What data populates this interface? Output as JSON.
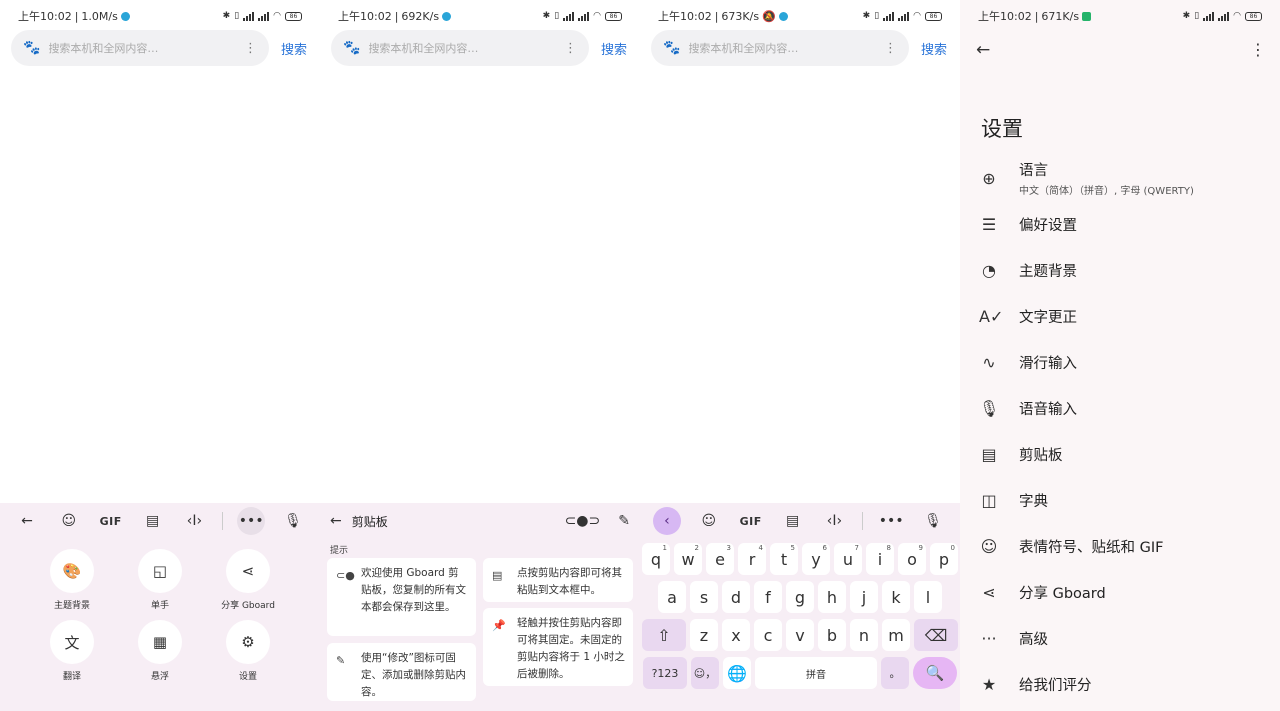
{
  "colors": {
    "accent_blue": "#2a74d8",
    "keyboard_bg": "#f7eef5",
    "key_fn": "#e9d8f0",
    "key_enter": "#e6b6f4",
    "settings_bg": "#fbf6f7"
  },
  "panels": [
    {
      "status": {
        "time": "上午10:02",
        "speed": "1.0M/s",
        "battery": "86"
      }
    },
    {
      "status": {
        "time": "上午10:02",
        "speed": "692K/s",
        "battery": "86"
      }
    },
    {
      "status": {
        "time": "上午10:02",
        "speed": "673K/s",
        "battery": "86"
      }
    },
    {
      "status": {
        "time": "上午10:02",
        "speed": "671K/s",
        "battery": "86"
      }
    }
  ],
  "search": {
    "placeholder": "搜索本机和全网内容…",
    "button": "搜索"
  },
  "toolbar": {
    "gif": "GIF"
  },
  "menu": {
    "items": [
      {
        "label": "主题背景",
        "icon": "palette-icon"
      },
      {
        "label": "单手",
        "icon": "one-hand-icon"
      },
      {
        "label": "分享 Gboard",
        "icon": "share-icon"
      },
      {
        "label": "翻译",
        "icon": "translate-icon"
      },
      {
        "label": "悬浮",
        "icon": "floating-keyboard-icon"
      },
      {
        "label": "设置",
        "icon": "gear-icon"
      }
    ]
  },
  "clipboard": {
    "title": "剪贴板",
    "tips_label": "提示",
    "tips": [
      "欢迎使用 Gboard 剪贴板，您复制的所有文本都会保存到这里。",
      "使用“修改”图标可固定、添加或删除剪贴内容。",
      "点按剪贴内容即可将其粘贴到文本框中。",
      "轻触并按住剪贴内容即可将其固定。未固定的剪贴内容将于 1 小时之后被删除。"
    ]
  },
  "keyboard": {
    "row1": [
      {
        "k": "q",
        "n": "1"
      },
      {
        "k": "w",
        "n": "2"
      },
      {
        "k": "e",
        "n": "3"
      },
      {
        "k": "r",
        "n": "4"
      },
      {
        "k": "t",
        "n": "5"
      },
      {
        "k": "y",
        "n": "6"
      },
      {
        "k": "u",
        "n": "7"
      },
      {
        "k": "i",
        "n": "8"
      },
      {
        "k": "o",
        "n": "9"
      },
      {
        "k": "p",
        "n": "0"
      }
    ],
    "row2": [
      "a",
      "s",
      "d",
      "f",
      "g",
      "h",
      "j",
      "k",
      "l"
    ],
    "row3": [
      "z",
      "x",
      "c",
      "v",
      "b",
      "n",
      "m"
    ],
    "num_key": "?123",
    "space": "拼音",
    "comma": "，",
    "period": "。"
  },
  "settings": {
    "title": "设置",
    "items": [
      {
        "label": "语言",
        "sub": "中文（简体）（拼音）, 字母 (QWERTY)",
        "icon": "globe-icon"
      },
      {
        "label": "偏好设置",
        "icon": "sliders-icon"
      },
      {
        "label": "主题背景",
        "icon": "palette-icon"
      },
      {
        "label": "文字更正",
        "icon": "spellcheck-icon"
      },
      {
        "label": "滑行输入",
        "icon": "glide-icon"
      },
      {
        "label": "语音输入",
        "icon": "mic-icon"
      },
      {
        "label": "剪贴板",
        "icon": "clipboard-icon"
      },
      {
        "label": "字典",
        "icon": "book-icon"
      },
      {
        "label": "表情符号、贴纸和 GIF",
        "icon": "emoji-icon"
      },
      {
        "label": "分享 Gboard",
        "icon": "share-icon"
      },
      {
        "label": "高级",
        "icon": "more-icon"
      },
      {
        "label": "给我们评分",
        "icon": "star-icon"
      }
    ]
  }
}
